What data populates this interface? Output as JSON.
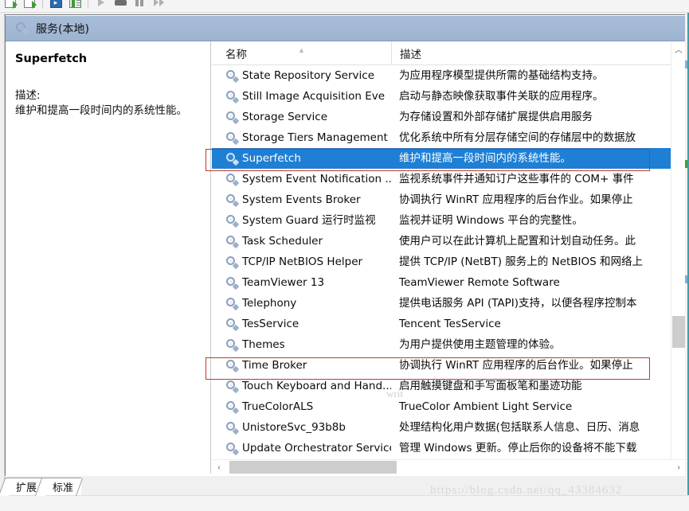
{
  "toolbar": {
    "buttons": [
      {
        "name": "export-list-icon",
        "label": ""
      },
      {
        "name": "export-green-arrow-icon",
        "label": ""
      },
      {
        "name": "properties-blue-icon",
        "label": ""
      },
      {
        "name": "help-green-icon",
        "label": ""
      },
      {
        "name": "start-service-icon",
        "label": ""
      },
      {
        "name": "stop-service-icon",
        "label": ""
      },
      {
        "name": "pause-service-icon",
        "label": ""
      },
      {
        "name": "restart-service-icon",
        "label": ""
      }
    ]
  },
  "console": {
    "title": "服务(本地)",
    "icon": "gear-icon"
  },
  "details": {
    "service_name": "Superfetch",
    "description_label": "描述:",
    "description_text": "维护和提高一段时间内的系统性能。"
  },
  "list": {
    "columns": [
      {
        "key": "name",
        "label": "名称",
        "sort": "ascending"
      },
      {
        "key": "description",
        "label": "描述"
      }
    ],
    "rows": [
      {
        "name": "State Repository Service",
        "description": "为应用程序模型提供所需的基础结构支持。",
        "selected": false
      },
      {
        "name": "Still Image Acquisition Eve",
        "description": "启动与静态映像获取事件关联的应用程序。",
        "selected": false
      },
      {
        "name": "Storage Service",
        "description": "为存储设置和外部存储扩展提供启用服务",
        "selected": false
      },
      {
        "name": "Storage Tiers Management",
        "description": "优化系统中所有分层存储空间的存储层中的数据放",
        "selected": false
      },
      {
        "name": "Superfetch",
        "description": "维护和提高一段时间内的系统性能。",
        "selected": true
      },
      {
        "name": "System Event Notification ...",
        "description": "监视系统事件并通知订户这些事件的 COM+ 事件",
        "selected": false
      },
      {
        "name": "System Events Broker",
        "description": "协调执行 WinRT 应用程序的后台作业。如果停止",
        "selected": false
      },
      {
        "name": "System Guard 运行时监视",
        "description": "监视并证明 Windows 平台的完整性。",
        "selected": false
      },
      {
        "name": "Task Scheduler",
        "description": "使用户可以在此计算机上配置和计划自动任务。此",
        "selected": false
      },
      {
        "name": "TCP/IP NetBIOS Helper",
        "description": "提供 TCP/IP (NetBT) 服务上的 NetBIOS 和网络上",
        "selected": false
      },
      {
        "name": "TeamViewer 13",
        "description": "TeamViewer Remote Software",
        "selected": false
      },
      {
        "name": "Telephony",
        "description": "提供电话服务 API (TAPI)支持，以便各程序控制本",
        "selected": false
      },
      {
        "name": "TesService",
        "description": "Tencent TesService",
        "selected": false
      },
      {
        "name": "Themes",
        "description": "为用户提供使用主题管理的体验。",
        "selected": false
      },
      {
        "name": "Time Broker",
        "description": "协调执行 WinRT 应用程序的后台作业。如果停止",
        "selected": false
      },
      {
        "name": "Touch Keyboard and Hand...",
        "description": "启用触摸键盘和手写面板笔和墨迹功能",
        "selected": false
      },
      {
        "name": "TrueColorALS",
        "description": "TrueColor Ambient Light Service",
        "selected": false
      },
      {
        "name": "UnistoreSvc_93b8b",
        "description": "处理结构化用户数据(包括联系人信息、日历、消息",
        "selected": false
      },
      {
        "name": "Update Orchestrator Service",
        "description": "管理 Windows 更新。停止后你的设备将不能下载",
        "selected": false
      }
    ]
  },
  "annotations": {
    "highlight_rows": [
      "Superfetch",
      "Time Broker"
    ],
    "highlight_color": "#c0392b",
    "selection_color": "#1f7fd4"
  },
  "scrollbars": {
    "vertical": {
      "up_glyph": "︿",
      "down_glyph": "﹀"
    },
    "horizontal": {
      "left_glyph": "‹",
      "right_glyph": "›"
    }
  },
  "tabs": [
    {
      "label": "扩展",
      "active": false
    },
    {
      "label": "标准",
      "active": true
    }
  ],
  "watermark": {
    "url": "https://blog.csdn.net/qq_43384632",
    "inline": "writ"
  }
}
